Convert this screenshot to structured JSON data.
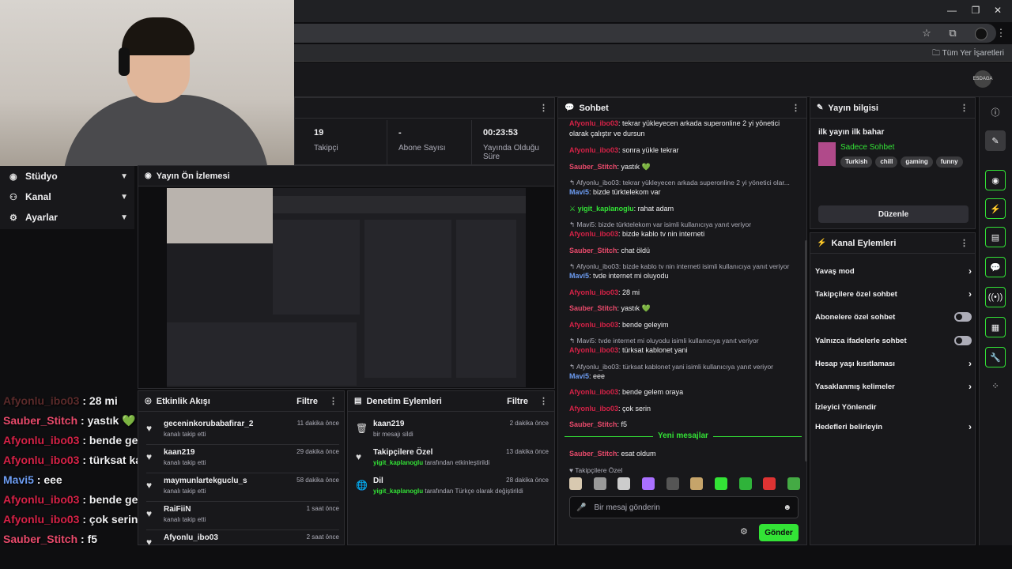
{
  "browser": {
    "bookmarks_label": "Tüm Yer İşaretleri",
    "profile_text": "ESDAGA"
  },
  "sidebar": {
    "items": [
      {
        "label": "Stüdyo"
      },
      {
        "label": "Kanal"
      },
      {
        "label": "Ayarlar"
      }
    ]
  },
  "stats": [
    {
      "value": "19",
      "label": "Takipçi"
    },
    {
      "value": "-",
      "label": "Abone Sayısı"
    },
    {
      "value": "00:23:53",
      "label": "Yayında Olduğu Süre"
    }
  ],
  "preview": {
    "title": "Yayın Ön İzlemesi"
  },
  "overlay_chat": [
    {
      "user": "Afyonlu_ibo03",
      "text": " : 28 mi",
      "color": "#5a2a2a"
    },
    {
      "user": "Sauber_Stitch",
      "text": " : yastık 💚",
      "color": "#e84a6b"
    },
    {
      "user": "Afyonlu_ibo03",
      "text": " : bende geleyim",
      "color": "#d62247"
    },
    {
      "user": "Afyonlu_ibo03",
      "text": " : türksat kablonet yani",
      "color": "#d62247"
    },
    {
      "user": "Mavi5",
      "text": " : eee",
      "color": "#6c9bf0"
    },
    {
      "user": "Afyonlu_ibo03",
      "text": " : bende gelem oraya",
      "color": "#d62247"
    },
    {
      "user": "Afyonlu_ibo03",
      "text": " : çok serin",
      "color": "#d62247"
    },
    {
      "user": "Sauber_Stitch",
      "text": " : f5",
      "color": "#e84a6b"
    },
    {
      "user": "Sauber_Stitch",
      "text": " : esat oldum",
      "color": "#e84a6b"
    }
  ],
  "activity": {
    "title": "Etkinlik Akışı",
    "filter": "Filtre",
    "items": [
      {
        "name": "geceninkorubabafirar_2",
        "sub": "kanalı takip etti",
        "time": "11 dakika önce"
      },
      {
        "name": "kaan219",
        "sub": "kanalı takip etti",
        "time": "29 dakika önce"
      },
      {
        "name": "maymunlartekguclu_s",
        "sub": "kanalı takip etti",
        "time": "58 dakika önce"
      },
      {
        "name": "RaiFiiN",
        "sub": "kanalı takip etti",
        "time": "1 saat önce"
      },
      {
        "name": "Afyonlu_ibo03",
        "sub": "",
        "time": "2 saat önce"
      }
    ]
  },
  "moderation": {
    "title": "Denetim Eylemleri",
    "filter": "Filtre",
    "items": [
      {
        "name": "kaan219",
        "actor": "",
        "sub": "bir mesajı sildi",
        "time": "2 dakika önce",
        "icon": "🗑"
      },
      {
        "name": "Takipçilere Özel",
        "actor": "yigit_kaplanoglu",
        "sub": " tarafından etkinleştirildi",
        "time": "13 dakika önce",
        "icon": "♥"
      },
      {
        "name": "Dil",
        "actor": "yigit_kaplanoglu",
        "sub": " tarafından Türkçe olarak değiştirildi",
        "time": "28 dakika önce",
        "icon": "🌐"
      }
    ]
  },
  "chat": {
    "title": "Sohbet",
    "new_messages": "Yeni mesajlar",
    "followers_only": "Takipçilere Özel",
    "placeholder": "Bir mesaj gönderin",
    "send": "Gönder",
    "messages": [
      {
        "user": "Afyonlu_ibo03",
        "color": "#d62247",
        "text": ": tekrar yükleyecen arkada superonline 2 yi yönetici olarak çalıştır ve dursun",
        "reply": ""
      },
      {
        "user": "Afyonlu_ibo03",
        "color": "#d62247",
        "text": ": sonra yükle tekrar",
        "reply": ""
      },
      {
        "user": "Sauber_Stitch",
        "color": "#e84a6b",
        "text": ": yastık 💚",
        "reply": ""
      },
      {
        "user": "Mavi5",
        "color": "#6c9bf0",
        "text": ": bizde türktelekom var",
        "reply": "↰ Afyonlu_ibo03: tekrar yükleyecen arkada superonline 2 yi yönetici olar..."
      },
      {
        "user": "yigit_kaplanoglu",
        "color": "#33e336",
        "text": ": rahat adam",
        "reply": ""
      },
      {
        "user": "Afyonlu_ibo03",
        "color": "#d62247",
        "text": ": bizde kablo tv nin interneti",
        "reply": "↰ Mavi5: bizde türktelekom var isimli kullanıcıya yanıt veriyor"
      },
      {
        "user": "Sauber_Stitch",
        "color": "#e84a6b",
        "text": ": chat öldü",
        "reply": ""
      },
      {
        "user": "Mavi5",
        "color": "#6c9bf0",
        "text": ": tvde internet mi oluyodu",
        "reply": "↰ Afyonlu_ibo03: bizde kablo tv nin interneti isimli kullanıcıya yanıt veriyor"
      },
      {
        "user": "Afyonlu_ibo03",
        "color": "#d62247",
        "text": ": 28 mi",
        "reply": ""
      },
      {
        "user": "Sauber_Stitch",
        "color": "#e84a6b",
        "text": ": yastık 💚",
        "reply": ""
      },
      {
        "user": "Afyonlu_ibo03",
        "color": "#d62247",
        "text": ": bende geleyim",
        "reply": ""
      },
      {
        "user": "Afyonlu_ibo03",
        "color": "#d62247",
        "text": ": türksat kablonet yani",
        "reply": "↰ Mavi5: tvde internet mi oluyodu isimli kullanıcıya yanıt veriyor"
      },
      {
        "user": "Mavi5",
        "color": "#6c9bf0",
        "text": ": eee",
        "reply": "↰ Afyonlu_ibo03: türksat kablonet yani isimli kullanıcıya yanıt veriyor"
      },
      {
        "user": "Afyonlu_ibo03",
        "color": "#d62247",
        "text": ": bende gelem oraya",
        "reply": ""
      },
      {
        "user": "Afyonlu_ibo03",
        "color": "#d62247",
        "text": ": çok serin",
        "reply": ""
      },
      {
        "user": "Sauber_Stitch",
        "color": "#e84a6b",
        "text": ": f5",
        "reply": ""
      }
    ],
    "after_new": {
      "user": "Sauber_Stitch",
      "color": "#e84a6b",
      "text": ": esat oldum"
    }
  },
  "stream_info": {
    "title": "Yayın bilgisi",
    "stream_title": "ilk yayın ilk bahar",
    "category": "Sadece Sohbet",
    "tags": [
      "Turkish",
      "chill",
      "gaming",
      "funny"
    ],
    "edit": "Düzenle"
  },
  "channel_actions": {
    "title": "Kanal Eylemleri",
    "items": [
      {
        "label": "Yavaş mod",
        "kind": "arrow"
      },
      {
        "label": "Takipçilere özel sohbet",
        "kind": "arrow"
      },
      {
        "label": "Abonelere özel sohbet",
        "kind": "toggle"
      },
      {
        "label": "Yalnızca ifadelerle sohbet",
        "kind": "toggle"
      },
      {
        "label": "Hesap yaşı kısıtlaması",
        "kind": "arrow"
      },
      {
        "label": "Yasaklanmış kelimeler",
        "kind": "arrow"
      },
      {
        "label": "İzleyici Yönlendir",
        "kind": "none"
      },
      {
        "label": "Hedefleri belirleyin",
        "kind": "arrow"
      }
    ]
  },
  "colors": {
    "accent": "#33e336",
    "bg": "#0e0e10",
    "panel": "#18181b"
  }
}
